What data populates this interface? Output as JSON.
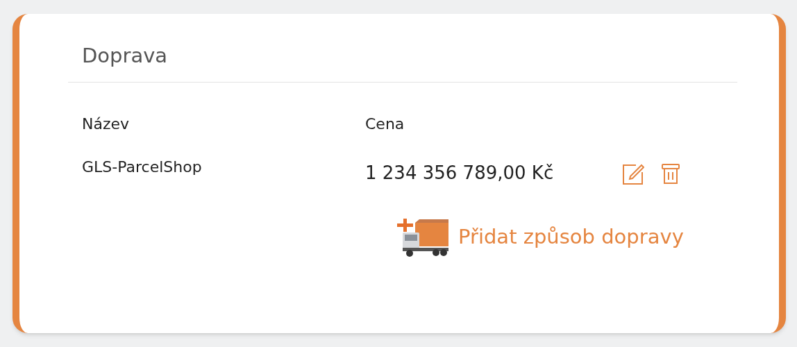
{
  "card": {
    "title": "Doprava"
  },
  "table": {
    "columns": [
      "Název",
      "Cena"
    ],
    "rows": [
      {
        "name": "GLS-ParcelShop",
        "price": "1 234 356 789,00 Kč"
      }
    ]
  },
  "add_link": {
    "label": "Přidat způsob dopravy"
  }
}
